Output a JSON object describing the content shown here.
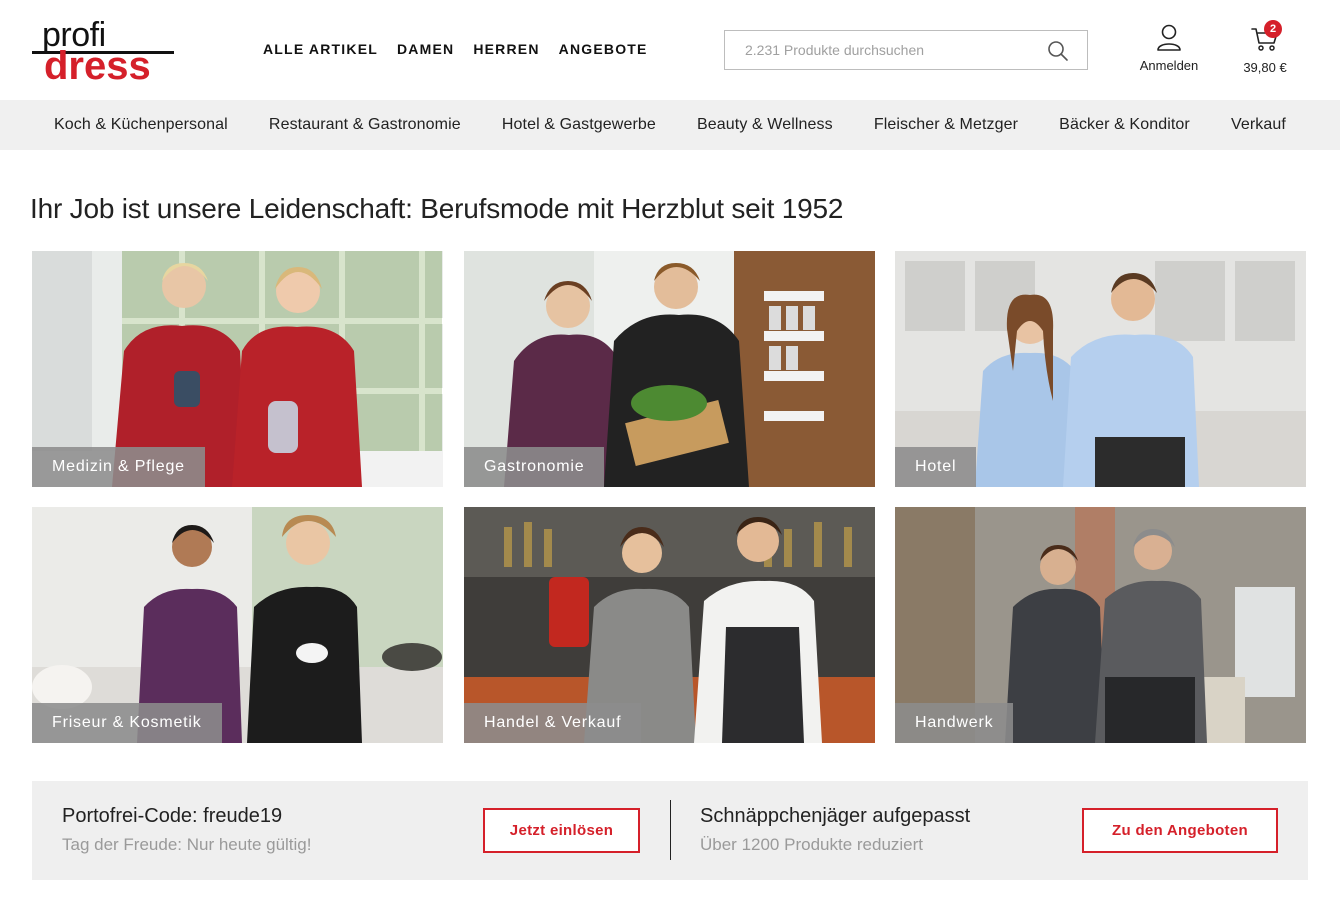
{
  "header": {
    "logo_top": "profi",
    "logo_bottom": "dress",
    "nav": [
      "ALLE ARTIKEL",
      "DAMEN",
      "HERREN",
      "ANGEBOTE"
    ],
    "search_placeholder": "2.231 Produkte durchsuchen",
    "account_label": "Anmelden",
    "cart_count": "2",
    "cart_total": "39,80 €"
  },
  "categories": [
    "Koch & Küchenpersonal",
    "Restaurant & Gastronomie",
    "Hotel & Gastgewerbe",
    "Beauty & Wellness",
    "Fleischer & Metzger",
    "Bäcker & Konditor",
    "Verkauf"
  ],
  "headline": "Ihr Job ist unsere Leidenschaft: Berufsmode mit Herzblut seit 1952",
  "tiles": [
    {
      "label": "Medizin & Pflege"
    },
    {
      "label": "Gastronomie"
    },
    {
      "label": "Hotel"
    },
    {
      "label": "Friseur & Kosmetik"
    },
    {
      "label": "Handel & Verkauf"
    },
    {
      "label": "Handwerk"
    }
  ],
  "promo": {
    "left_title": "Portofrei-Code: freude19",
    "left_sub": "Tag der Freude: Nur heute gültig!",
    "left_button": "Jetzt einlösen",
    "right_title": "Schnäppchenjäger aufgepasst",
    "right_sub": "Über 1200 Produkte reduziert",
    "right_button": "Zu den Angeboten"
  },
  "colors": {
    "brand_red": "#d5202a",
    "nav_bg": "#f0f0f0",
    "tile_label_bg": "#8c8c8c"
  }
}
